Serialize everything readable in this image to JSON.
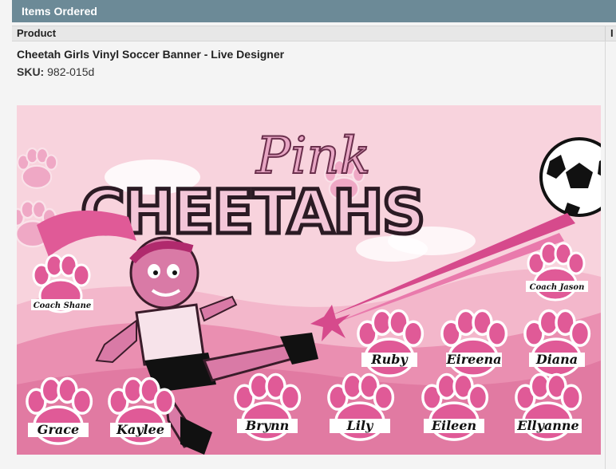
{
  "section": {
    "title": "Items Ordered"
  },
  "table": {
    "col_product": "Product",
    "col_next": "I"
  },
  "item": {
    "title": "Cheetah Girls Vinyl Soccer Banner - Live Designer",
    "sku_label": "SKU:",
    "sku_value": "982-015d"
  },
  "banner": {
    "headline_small": "Pink",
    "headline_big": "CHEETAHS",
    "coaches": [
      "Coach Shane",
      "Coach Jason"
    ],
    "players": [
      "Ruby",
      "Eireena",
      "Diana",
      "Grace",
      "Kaylee",
      "Brynn",
      "Lily",
      "Eileen",
      "Ellyanne"
    ],
    "colors": {
      "bg": "#f8d3dd",
      "pink": "#e05a97",
      "dark_pink": "#c2407d",
      "light": "#fbe4ea"
    }
  }
}
